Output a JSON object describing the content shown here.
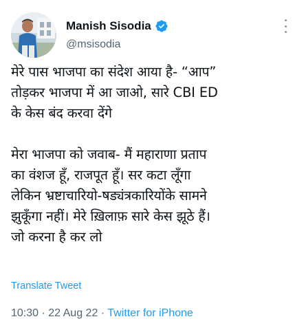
{
  "tweet": {
    "author_name": "Manish Sisodia",
    "author_handle": "@msisodia",
    "verified_icon": "verified-badge-icon",
    "paragraph_1": "मेरे पास भाजपा का संदेश आया है- “आप”\nतोड़कर भाजपा में आ जाओ, सारे CBI ED\nके केस बंद करवा देंगे",
    "paragraph_2": "मेरा भाजपा को जवाब- मैं महाराणा प्रताप\nका वंशज हूँ, राजपूत हूँ। सर कटा लूँगा\nलेकिन भ्रष्टाचारियो-षड्यंत्रकारियोंके सामने\nझुकूँगा नहीं। मेरे ख़िलाफ़ सारे केस झूठे हैं।\nजो करना है कर लो",
    "translate_label": "Translate Tweet",
    "time": "10:30",
    "separator": " · ",
    "date": "22 Aug 22",
    "source": "Twitter for iPhone"
  },
  "colors": {
    "accent": "#1d9bf0",
    "secondary_text": "#536471",
    "primary_text": "#0f1419"
  }
}
